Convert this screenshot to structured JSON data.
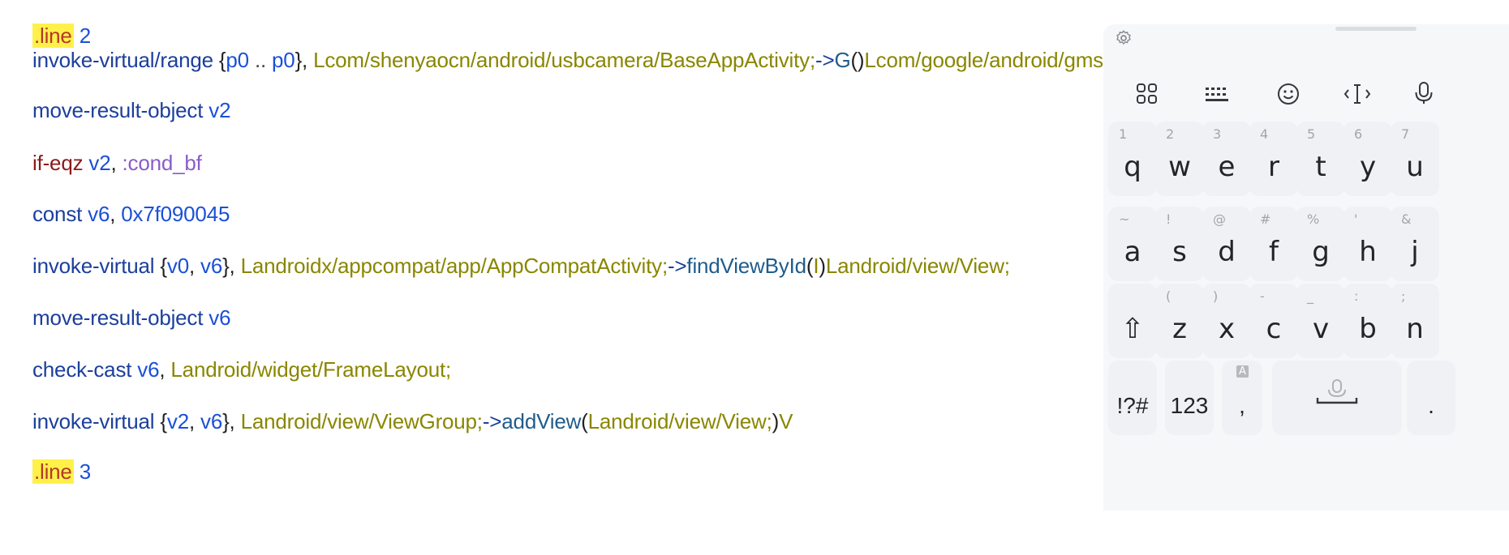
{
  "editor": {
    "lines": [
      {
        "row": 0,
        "tokens": [
          {
            "t": ".line",
            "c": "tok-directive"
          },
          {
            "t": " 2",
            "c": "tok-number"
          }
        ]
      },
      {
        "row": 1,
        "tokens": [
          {
            "t": "invoke-virtual/range ",
            "c": "tok-op"
          },
          {
            "t": "{",
            "c": "tok-punct"
          },
          {
            "t": "p0",
            "c": "tok-reg"
          },
          {
            "t": " .. ",
            "c": "tok-sep"
          },
          {
            "t": "p0",
            "c": "tok-reg"
          },
          {
            "t": "}, ",
            "c": "tok-punct"
          },
          {
            "t": "Lcom/shenyaocn/android/usbcamera/BaseAppActivity;",
            "c": "tok-type"
          },
          {
            "t": "->",
            "c": "tok-op"
          },
          {
            "t": "G",
            "c": "tok-method"
          },
          {
            "t": "()",
            "c": "tok-punct"
          },
          {
            "t": "Lcom/google/android/gms/ads/AdView;",
            "c": "tok-type"
          }
        ]
      },
      {
        "row": 2,
        "tokens": [
          {
            "t": "move-result-object ",
            "c": "tok-op"
          },
          {
            "t": "v2",
            "c": "tok-reg"
          }
        ]
      },
      {
        "row": 3,
        "tokens": [
          {
            "t": "if-eqz ",
            "c": "tok-cond"
          },
          {
            "t": "v2",
            "c": "tok-reg"
          },
          {
            "t": ", ",
            "c": "tok-punct"
          },
          {
            "t": ":cond_bf",
            "c": "tok-label"
          }
        ]
      },
      {
        "row": 4,
        "tokens": [
          {
            "t": "const ",
            "c": "tok-op"
          },
          {
            "t": "v6",
            "c": "tok-reg"
          },
          {
            "t": ", ",
            "c": "tok-punct"
          },
          {
            "t": "0x7f090045",
            "c": "tok-number"
          }
        ]
      },
      {
        "row": 5,
        "tokens": [
          {
            "t": "invoke-virtual ",
            "c": "tok-op"
          },
          {
            "t": "{",
            "c": "tok-punct"
          },
          {
            "t": "v0",
            "c": "tok-reg"
          },
          {
            "t": ", ",
            "c": "tok-punct"
          },
          {
            "t": "v6",
            "c": "tok-reg"
          },
          {
            "t": "}, ",
            "c": "tok-punct"
          },
          {
            "t": "Landroidx/appcompat/app/AppCompatActivity;",
            "c": "tok-type"
          },
          {
            "t": "->",
            "c": "tok-op"
          },
          {
            "t": "findViewById",
            "c": "tok-method"
          },
          {
            "t": "(",
            "c": "tok-punct"
          },
          {
            "t": "I",
            "c": "tok-type"
          },
          {
            "t": ")",
            "c": "tok-punct"
          },
          {
            "t": "Landroid/view/View;",
            "c": "tok-type"
          }
        ]
      },
      {
        "row": 6,
        "tokens": [
          {
            "t": "move-result-object ",
            "c": "tok-op"
          },
          {
            "t": "v6",
            "c": "tok-reg"
          }
        ]
      },
      {
        "row": 7,
        "tokens": [
          {
            "t": "check-cast ",
            "c": "tok-op"
          },
          {
            "t": "v6",
            "c": "tok-reg"
          },
          {
            "t": ", ",
            "c": "tok-punct"
          },
          {
            "t": "Landroid/widget/FrameLayout;",
            "c": "tok-type"
          }
        ]
      },
      {
        "row": 8,
        "tokens": [
          {
            "t": "invoke-virtual ",
            "c": "tok-op"
          },
          {
            "t": "{",
            "c": "tok-punct"
          },
          {
            "t": "v2",
            "c": "tok-reg"
          },
          {
            "t": ", ",
            "c": "tok-punct"
          },
          {
            "t": "v6",
            "c": "tok-reg"
          },
          {
            "t": "}, ",
            "c": "tok-punct"
          },
          {
            "t": "Landroid/view/ViewGroup;",
            "c": "tok-type"
          },
          {
            "t": "->",
            "c": "tok-op"
          },
          {
            "t": "addView",
            "c": "tok-method"
          },
          {
            "t": "(",
            "c": "tok-punct"
          },
          {
            "t": "Landroid/view/View;",
            "c": "tok-type"
          },
          {
            "t": ")",
            "c": "tok-punct"
          },
          {
            "t": "V",
            "c": "tok-type"
          }
        ]
      },
      {
        "row": 9,
        "tokens": [
          {
            "t": ".line",
            "c": "tok-directive"
          },
          {
            "t": " 3",
            "c": "tok-number"
          }
        ]
      }
    ]
  },
  "keyboard": {
    "toolbar": [
      "settings-icon",
      "apps-grid-icon",
      "keyboard-icon",
      "emoji-icon",
      "cursor-move-icon",
      "microphone-icon"
    ],
    "rows": [
      {
        "keys": [
          {
            "main": "q",
            "sub": "1"
          },
          {
            "main": "w",
            "sub": "2"
          },
          {
            "main": "e",
            "sub": "3"
          },
          {
            "main": "r",
            "sub": "4"
          },
          {
            "main": "t",
            "sub": "5"
          },
          {
            "main": "y",
            "sub": "6"
          },
          {
            "main": "u",
            "sub": "7"
          }
        ]
      },
      {
        "keys": [
          {
            "main": "a",
            "sub": "~"
          },
          {
            "main": "s",
            "sub": "!"
          },
          {
            "main": "d",
            "sub": "@"
          },
          {
            "main": "f",
            "sub": "#"
          },
          {
            "main": "g",
            "sub": "%"
          },
          {
            "main": "h",
            "sub": "'"
          },
          {
            "main": "j",
            "sub": "&"
          }
        ]
      },
      {
        "keys": [
          {
            "main": "⇧",
            "sub": ""
          },
          {
            "main": "z",
            "sub": "("
          },
          {
            "main": "x",
            "sub": ")"
          },
          {
            "main": "c",
            "sub": "-"
          },
          {
            "main": "v",
            "sub": "_"
          },
          {
            "main": "b",
            "sub": ":"
          },
          {
            "main": "n",
            "sub": ";"
          }
        ]
      },
      {
        "keys": [
          {
            "main": "!?#",
            "sub": ""
          },
          {
            "main": "123",
            "sub": ""
          },
          {
            "main": ",",
            "sub": "A"
          },
          {
            "main": "",
            "sub": ""
          },
          {
            "main": ".",
            "sub": ""
          }
        ]
      }
    ]
  }
}
